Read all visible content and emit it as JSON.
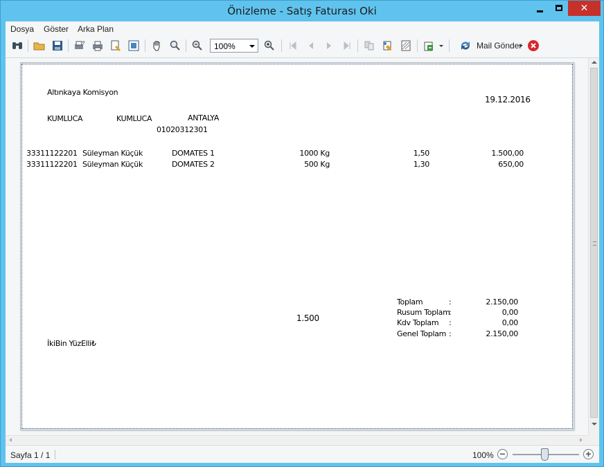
{
  "window": {
    "title": "Önizleme - Satış Faturası Oki"
  },
  "menu": {
    "items": [
      "Dosya",
      "Göster",
      "Arka Plan"
    ]
  },
  "toolbar": {
    "zoom_value": "100%",
    "mail_label": "Mail Gönder"
  },
  "invoice": {
    "company": "Altınkaya Komisyon",
    "date": "19.12.2016",
    "address": [
      "KUMLUCA",
      "KUMLUCA",
      "ANTALYA"
    ],
    "tax_number": "01020312301",
    "rows": [
      {
        "code": "33311122201",
        "name": "Süleyman Küçük",
        "product": "DOMATES 1",
        "qty": "1000 Kg",
        "price": "1,50",
        "amount": "1.500,00"
      },
      {
        "code": "33311122201",
        "name": "Süleyman Küçük",
        "product": "DOMATES 2",
        "qty": "500 Kg",
        "price": "1,30",
        "amount": "650,00"
      }
    ],
    "middle_total": "1.500",
    "totals": [
      {
        "label": "Toplam",
        "sep": ":",
        "value": "2.150,00"
      },
      {
        "label": "Rusum Toplam",
        "sep": ":",
        "value": "0,00"
      },
      {
        "label": "Kdv Toplam",
        "sep": ":",
        "value": "0,00"
      },
      {
        "label": "Genel Toplam",
        "sep": ":",
        "value": "2.150,00"
      }
    ],
    "amount_in_words": "İkiBin YüzElli₺"
  },
  "status": {
    "page": "Sayfa 1 / 1",
    "zoom": "100%"
  },
  "colors": {
    "titlebar": "#5fc3ee",
    "close_button": "#c7312b"
  }
}
